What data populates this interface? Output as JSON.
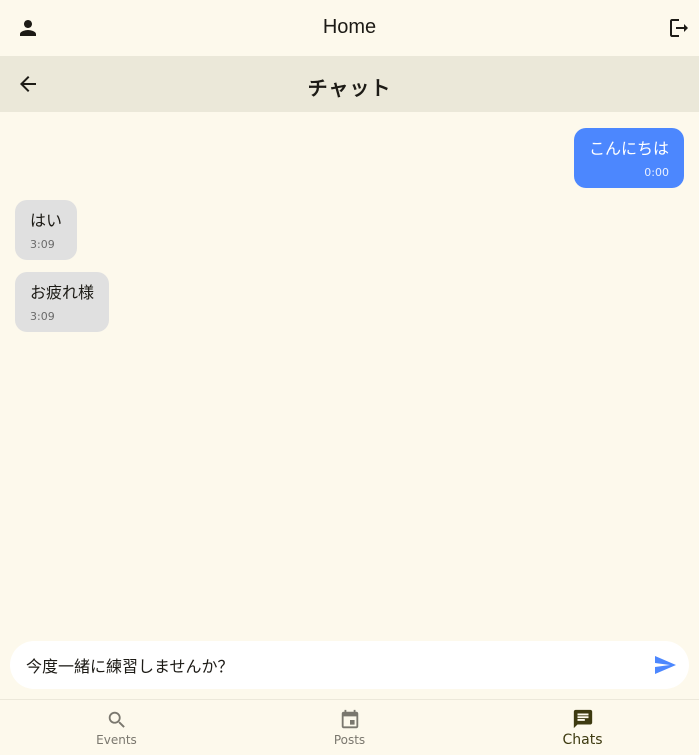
{
  "app": {
    "title": "Home"
  },
  "icons": {
    "profile": "person-icon",
    "logout": "logout-icon",
    "back": "arrow-back-icon",
    "send": "send-icon"
  },
  "chat": {
    "title": "チャット",
    "messages": [
      {
        "sender": "me",
        "text": "こんにちは",
        "time": "0:00"
      },
      {
        "sender": "other",
        "text": "はい",
        "time": "3:09"
      },
      {
        "sender": "other",
        "text": "お疲れ様",
        "time": "3:09"
      }
    ]
  },
  "composer": {
    "value": "今度一緒に練習しませんか？"
  },
  "nav": {
    "items": [
      {
        "label": "Events",
        "icon": "search-icon",
        "active": false
      },
      {
        "label": "Posts",
        "icon": "calendar-icon",
        "active": false
      },
      {
        "label": "Chats",
        "icon": "chat-icon",
        "active": true
      }
    ]
  },
  "colors": {
    "background": "#fdf9ec",
    "header": "#ebe8d9",
    "my_bubble": "#4c87fe",
    "their_bubble": "#e0e0e0",
    "active_nav": "#3d3a10"
  }
}
